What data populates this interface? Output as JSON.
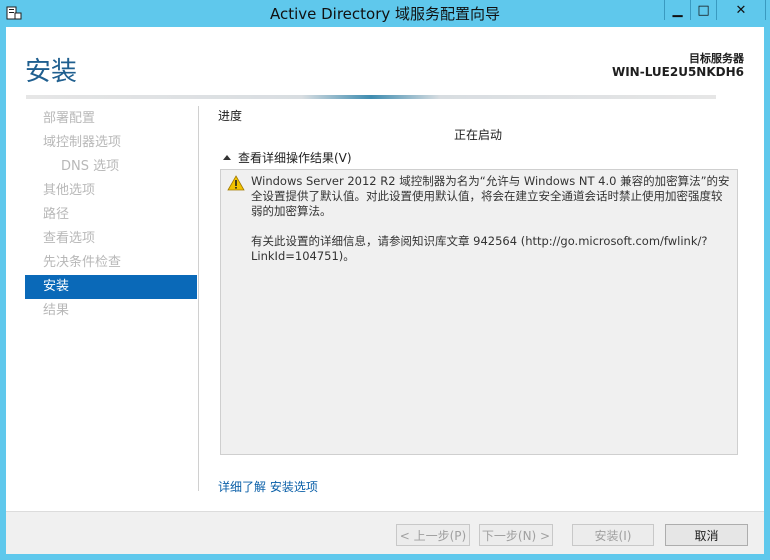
{
  "window": {
    "title": "Active Directory 域服务配置向导",
    "minimize_glyph": "▁",
    "maximize_glyph": "□",
    "close_glyph": "✕"
  },
  "header": {
    "page_title": "安装",
    "target_label": "目标服务器",
    "target_name": "WIN-LUE2U5NKDH6"
  },
  "sidebar": {
    "items": [
      {
        "label": "部署配置",
        "state": "disabled"
      },
      {
        "label": "域控制器选项",
        "state": "disabled"
      },
      {
        "label": "DNS 选项",
        "state": "disabled",
        "sub": true
      },
      {
        "label": "其他选项",
        "state": "disabled"
      },
      {
        "label": "路径",
        "state": "disabled"
      },
      {
        "label": "查看选项",
        "state": "disabled"
      },
      {
        "label": "先决条件检查",
        "state": "disabled"
      },
      {
        "label": "安装",
        "state": "active"
      },
      {
        "label": "结果",
        "state": "disabled"
      }
    ]
  },
  "main": {
    "progress_label": "进度",
    "status": "正在启动",
    "details_toggle": "查看详细操作结果(V)",
    "message_p1": "Windows Server 2012 R2 域控制器为名为“允许与 Windows NT 4.0 兼容的加密算法”的安全设置提供了默认值。对此设置使用默认值，将会在建立安全通道会话时禁止使用加密强度较弱的加密算法。",
    "message_p2": "有关此设置的详细信息，请参阅知识库文章 942564 (http://go.microsoft.com/fwlink/?LinkId=104751)。",
    "learn_more": "详细了解 安装选项"
  },
  "footer": {
    "prev": "< 上一步(P)",
    "next": "下一步(N) >",
    "install": "安装(I)",
    "cancel": "取消"
  },
  "colors": {
    "titlebar": "#5fc8ec",
    "accent": "#0a69b8",
    "title_text": "#1f5f8f",
    "warning": "#f2c200"
  }
}
